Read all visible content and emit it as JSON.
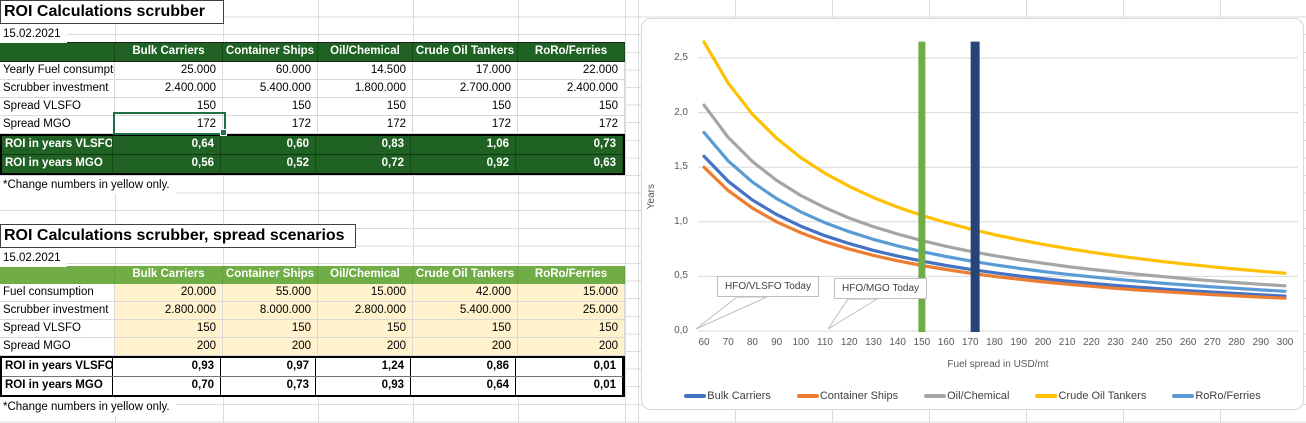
{
  "sheet": {
    "table1": {
      "title": "ROI Calculations scrubber",
      "date": "15.02.2021",
      "columns": [
        "Bulk Carriers",
        "Container Ships",
        "Oil/Chemical",
        "Crude Oil Tankers",
        "RoRo/Ferries"
      ],
      "rows": [
        {
          "label": "Yearly Fuel consumption",
          "values": [
            "25.000",
            "60.000",
            "14.500",
            "17.000",
            "22.000"
          ]
        },
        {
          "label": "Scrubber investment",
          "values": [
            "2.400.000",
            "5.400.000",
            "1.800.000",
            "2.700.000",
            "2.400.000"
          ]
        },
        {
          "label": "Spread VLSFO",
          "values": [
            "150",
            "150",
            "150",
            "150",
            "150"
          ]
        },
        {
          "label": "Spread MGO",
          "values": [
            "172",
            "172",
            "172",
            "172",
            "172"
          ]
        }
      ],
      "roi_rows": [
        {
          "label": "ROI in years VLSFO",
          "values": [
            "0,64",
            "0,60",
            "0,83",
            "1,06",
            "0,73"
          ]
        },
        {
          "label": "ROI in years MGO",
          "values": [
            "0,56",
            "0,52",
            "0,72",
            "0,92",
            "0,63"
          ]
        }
      ],
      "note": "*Change numbers in yellow only.",
      "selected_cell": {
        "row_label": "Spread MGO",
        "column": "Bulk Carriers",
        "value": "172",
        "row": 3,
        "col": 0
      }
    },
    "table2": {
      "title": "ROI Calculations scrubber, spread scenarios",
      "date": "15.02.2021",
      "columns": [
        "Bulk Carriers",
        "Container Ships",
        "Oil/Chemical",
        "Crude Oil Tankers",
        "RoRo/Ferries"
      ],
      "rows": [
        {
          "label": "Fuel consumption",
          "values": [
            "20.000",
            "55.000",
            "15.000",
            "42.000",
            "15.000"
          ]
        },
        {
          "label": "Scrubber investment",
          "values": [
            "2.800.000",
            "8.000.000",
            "2.800.000",
            "5.400.000",
            "25.000"
          ]
        },
        {
          "label": "Spread VLSFO",
          "values": [
            "150",
            "150",
            "150",
            "150",
            "150"
          ]
        },
        {
          "label": "Spread MGO",
          "values": [
            "200",
            "200",
            "200",
            "200",
            "200"
          ]
        }
      ],
      "roi_rows": [
        {
          "label": "ROI in years VLSFO",
          "values": [
            "0,93",
            "0,97",
            "1,24",
            "0,86",
            "0,01"
          ]
        },
        {
          "label": "ROI in years MGO",
          "values": [
            "0,70",
            "0,73",
            "0,93",
            "0,64",
            "0,01"
          ]
        }
      ],
      "note": "*Change numbers in yellow only."
    }
  },
  "chart_data": {
    "type": "line",
    "xlabel": "Fuel spread in USD/mt",
    "ylabel": "Years",
    "x": [
      60,
      70,
      80,
      90,
      100,
      110,
      120,
      130,
      140,
      150,
      160,
      170,
      180,
      190,
      200,
      210,
      220,
      230,
      240,
      250,
      260,
      270,
      280,
      290,
      300
    ],
    "yticks": [
      "0,0",
      "0,5",
      "1,0",
      "1,5",
      "2,0",
      "2,5"
    ],
    "ylim": [
      0,
      2.75
    ],
    "grid": "horizontal",
    "legend_position": "bottom",
    "series": [
      {
        "name": "Bulk Carriers",
        "color": "#4472C4",
        "values": [
          1.6,
          1.371,
          1.2,
          1.067,
          0.96,
          0.873,
          0.8,
          0.738,
          0.686,
          0.64,
          0.6,
          0.565,
          0.533,
          0.505,
          0.48,
          0.457,
          0.436,
          0.417,
          0.4,
          0.384,
          0.369,
          0.356,
          0.343,
          0.331,
          0.32
        ]
      },
      {
        "name": "Container Ships",
        "color": "#ED7D31",
        "values": [
          1.5,
          1.286,
          1.125,
          1.0,
          0.9,
          0.818,
          0.75,
          0.692,
          0.643,
          0.6,
          0.563,
          0.529,
          0.5,
          0.474,
          0.45,
          0.429,
          0.409,
          0.391,
          0.375,
          0.36,
          0.346,
          0.333,
          0.321,
          0.31,
          0.3
        ]
      },
      {
        "name": "Oil/Chemical",
        "color": "#A5A5A5",
        "values": [
          2.069,
          1.773,
          1.552,
          1.379,
          1.241,
          1.129,
          1.034,
          0.955,
          0.887,
          0.828,
          0.776,
          0.73,
          0.69,
          0.653,
          0.621,
          0.591,
          0.564,
          0.54,
          0.517,
          0.497,
          0.477,
          0.46,
          0.443,
          0.428,
          0.414
        ]
      },
      {
        "name": "Crude Oil Tankers",
        "color": "#FFC000",
        "values": [
          2.647,
          2.269,
          1.985,
          1.765,
          1.588,
          1.444,
          1.324,
          1.222,
          1.134,
          1.059,
          0.993,
          0.934,
          0.882,
          0.836,
          0.794,
          0.756,
          0.722,
          0.69,
          0.662,
          0.635,
          0.611,
          0.588,
          0.567,
          0.548,
          0.529
        ]
      },
      {
        "name": "RoRo/Ferries",
        "color": "#5B9BD5",
        "values": [
          1.818,
          1.558,
          1.364,
          1.212,
          1.091,
          0.992,
          0.909,
          0.839,
          0.779,
          0.727,
          0.682,
          0.642,
          0.606,
          0.574,
          0.545,
          0.519,
          0.496,
          0.474,
          0.455,
          0.436,
          0.42,
          0.404,
          0.39,
          0.376,
          0.364
        ]
      }
    ],
    "markers": [
      {
        "x": 150,
        "top": 2.65,
        "color": "#70AD47"
      },
      {
        "x": 172,
        "top": 2.65,
        "color": "#264478"
      }
    ],
    "annotations": [
      {
        "text": "HFO/VLSFO Today"
      },
      {
        "text": "HFO/MGO Today"
      }
    ]
  },
  "colors": {
    "table1_header": "#1F6223",
    "table2_header": "#70AD47",
    "editable_fill": "#FFF2CC",
    "selection": "#1E7145",
    "gridline": "#DCDCDC",
    "chart_gridline": "#D9D9D9",
    "chart_text": "#595959"
  }
}
